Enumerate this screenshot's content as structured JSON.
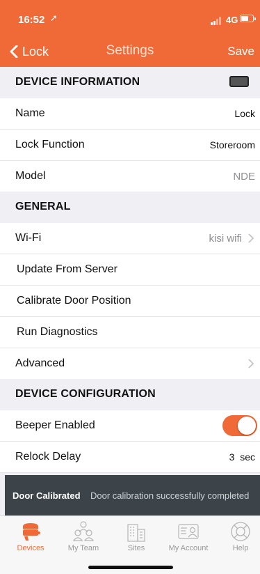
{
  "status_bar": {
    "time": "16:52",
    "network": "4G"
  },
  "nav": {
    "back_label": "Lock",
    "title": "Settings",
    "save_label": "Save"
  },
  "sections": {
    "device_information": {
      "title": "DEVICE INFORMATION",
      "name": {
        "label": "Name",
        "value": "Lock"
      },
      "lock_function": {
        "label": "Lock Function",
        "value": "Storeroom"
      },
      "model": {
        "label": "Model",
        "value": "NDE"
      }
    },
    "general": {
      "title": "GENERAL",
      "wifi": {
        "label": "Wi-Fi",
        "value": "kisi wifi"
      },
      "update": {
        "label": "Update From Server"
      },
      "calibrate": {
        "label": "Calibrate Door Position"
      },
      "diagnostics": {
        "label": "Run Diagnostics"
      },
      "advanced": {
        "label": "Advanced"
      }
    },
    "device_configuration": {
      "title": "DEVICE CONFIGURATION",
      "beeper": {
        "label": "Beeper Enabled",
        "enabled": true
      },
      "relock": {
        "label": "Relock Delay",
        "value": "3  sec"
      }
    }
  },
  "toast": {
    "title": "Door Calibrated",
    "message": "Door calibration successfully completed"
  },
  "tabs": [
    {
      "label": "Devices",
      "icon": "lock-device-icon",
      "active": true
    },
    {
      "label": "My Team",
      "icon": "team-icon",
      "active": false
    },
    {
      "label": "Sites",
      "icon": "building-icon",
      "active": false
    },
    {
      "label": "My Account",
      "icon": "id-card-icon",
      "active": false
    },
    {
      "label": "Help",
      "icon": "lifebuoy-icon",
      "active": false
    }
  ],
  "colors": {
    "accent": "#ef6a36",
    "toast_bg": "#3d4449",
    "background": "#efeff4"
  }
}
